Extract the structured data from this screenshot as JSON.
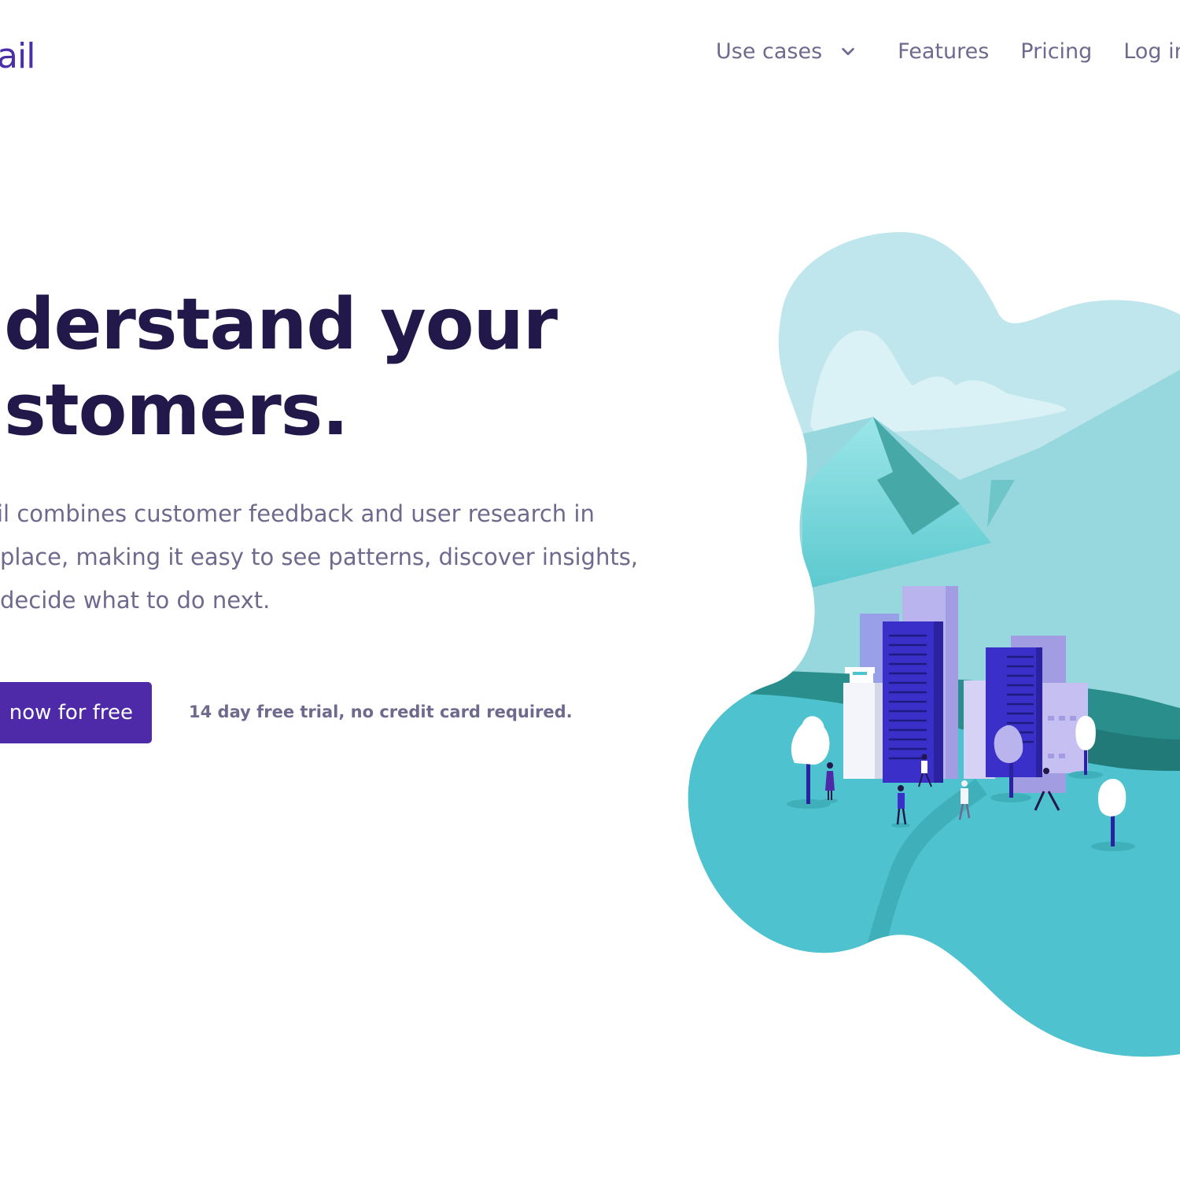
{
  "brand": {
    "logo_text": "ail"
  },
  "nav": {
    "use_cases": "Use cases",
    "features": "Features",
    "pricing": "Pricing",
    "login": "Log in"
  },
  "hero": {
    "title_line1": "nderstand your",
    "title_line2": "ustomers.",
    "description": "etail combines customer feedback and user research in place, making it easy to see patterns, discover insights, decide what to do next.",
    "description_lines": [
      "etail combines customer feedback and user research in",
      "place, making it easy to see patterns, discover insights,",
      "decide what to do next."
    ],
    "cta_label": "now for free",
    "cta_note": "14 day free trial, no credit card required."
  },
  "colors": {
    "brand_purple": "#4f2aa8",
    "heading": "#22184a",
    "body_text": "#6e6a8e",
    "teal": "#4fc2cf",
    "sky": "#bfe6ec"
  },
  "icons": {
    "use_cases_dropdown": "chevron-down-icon"
  }
}
